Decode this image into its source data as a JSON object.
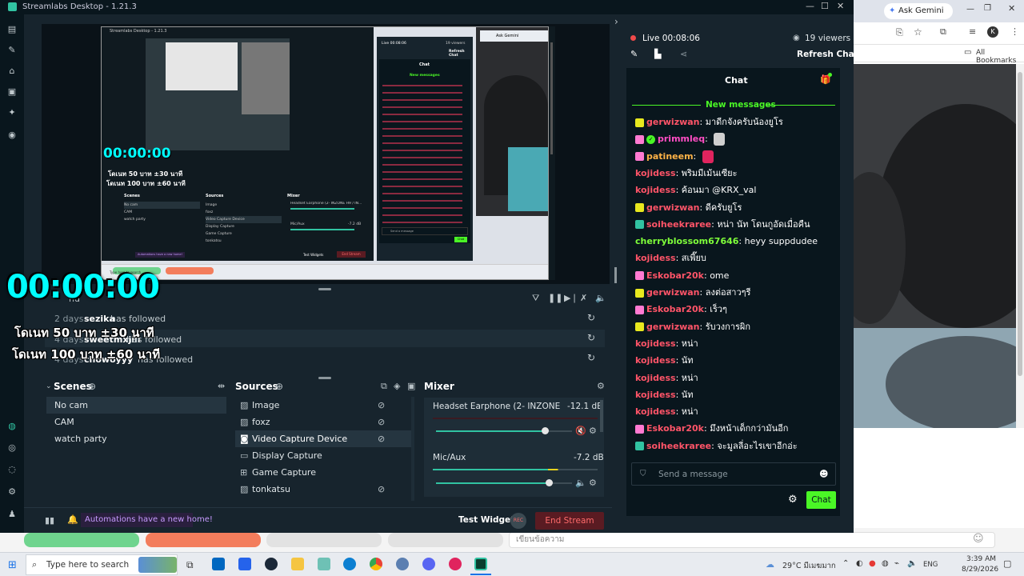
{
  "app": {
    "title": "Streamlabs Desktop - 1.21.3"
  },
  "preview": {
    "timer": "00:00:00",
    "promo_line_1": "โดเนท 50 บาท ±30 นาที",
    "promo_line_2": "โดเนท 100 บาท ±60 นาที",
    "mini_live_label": "Live 00:08:06",
    "mini_viewers": "19 viewers",
    "mini_chat_title": "Chat",
    "mini_refresh": "Refresh Chat",
    "mini_new_messages": "New messages",
    "mini_send_placeholder": "Send a message",
    "mini_chat_button": "Chat",
    "mini_scenes": "Scenes",
    "mini_sources": "Sources",
    "mini_mixer": "Mixer",
    "mini_timer_small": "00:00:00",
    "mini_promo_small_1": "โดเนท 50 บาท ±30 นาที",
    "mini_promo_small_2": "โดเนท 100 บาท ±60 นาที",
    "mini_title": "Streamlabs Desktop - 1.21.3",
    "mini_scene_items": [
      "No cam",
      "CAM",
      "watch party"
    ],
    "mini_source_items": [
      "Image",
      "foxz",
      "Video Capture Device",
      "Display Capture",
      "Game Capture",
      "tonkatsu"
    ],
    "mini_mixer_channel": "Headset Earphone (2- INZONE H9 / IN...",
    "mini_mixer_db": "-12.1 dB",
    "mini_mic_label": "Mic/Aux",
    "mini_mic_db": "-7.2 dB",
    "mini_automations": "Automations have a new home!",
    "mini_test_widgets": "Test Widgets",
    "mini_end_stream": "End Stream",
    "mini_search_placeholder": "Type here to search",
    "mini_tab_label": "Ask Gemini"
  },
  "activity": {
    "title_partial": "nd",
    "rows": [
      {
        "days": "2 days",
        "user": "sezika",
        "action": "has followed"
      },
      {
        "days": "4 days",
        "user": "sweetmxjiii",
        "action": "has followed"
      },
      {
        "days": "4 days",
        "user": "chowoyyy",
        "action": "has followed"
      }
    ]
  },
  "scenes": {
    "title": "Scenes",
    "items": [
      "No cam",
      "CAM",
      "watch party"
    ],
    "selected": "No cam"
  },
  "sources": {
    "title": "Sources",
    "items": [
      {
        "label": "Image",
        "icon": "image-icon"
      },
      {
        "label": "foxz",
        "icon": "image-icon"
      },
      {
        "label": "Video Capture Device",
        "icon": "camera-icon"
      },
      {
        "label": "Display Capture",
        "icon": "monitor-icon"
      },
      {
        "label": "Game Capture",
        "icon": "gamepad-icon"
      },
      {
        "label": "tonkatsu",
        "icon": "image-icon"
      }
    ],
    "selected": "Video Capture Device"
  },
  "mixer": {
    "title": "Mixer",
    "channels": [
      {
        "name": "Headset Earphone (2- INZONE H9 / IN...",
        "db": "-12.1 dB",
        "level": 0.8
      },
      {
        "name": "Mic/Aux",
        "db": "-7.2 dB",
        "level": 0.83
      }
    ]
  },
  "footer": {
    "automations": "Automations have a new home!",
    "test_widgets": "Test Widgets",
    "end_stream": "End Stream"
  },
  "chat": {
    "live_label": "Live 00:08:06",
    "viewers": "19 viewers",
    "refresh": "Refresh Chat",
    "title": "Chat",
    "new_messages": "New messages",
    "send_placeholder": "Send a message",
    "chat_button": "Chat",
    "messages": [
      {
        "user": "gerwizwan",
        "text": "มาดีกจังครับน้องยูโร",
        "color": "#ff5468",
        "badge": "#e8e81e"
      },
      {
        "user": "primmleq",
        "text": "",
        "color": "#ff4dc4",
        "badge": "#ff7ad1",
        "verified": true
      },
      {
        "user": "patineem",
        "text": "",
        "color": "#ffb347",
        "badge": "#ff7ad1"
      },
      {
        "user": "kojidess",
        "text": "พริมมีเม้นเซียะ",
        "color": "#ff5468",
        "badge": ""
      },
      {
        "user": "kojidess",
        "text": "ค้อนมา @KRX_val",
        "color": "#ff5468",
        "badge": ""
      },
      {
        "user": "gerwizwan",
        "text": "ดีครับยูโร",
        "color": "#ff5468",
        "badge": "#e8e81e"
      },
      {
        "user": "soiheekraree",
        "text": "หน่า นัท โดนกูอัดเมื่อคืน",
        "color": "#ff5468",
        "badge": "#31c3a2"
      },
      {
        "user": "cherryblossom67646",
        "text": "heyy suppdudee",
        "color": "#7fff3a",
        "badge": ""
      },
      {
        "user": "kojidess",
        "text": "สเพี๊ยบ",
        "color": "#ff5468",
        "badge": ""
      },
      {
        "user": "Eskobar20k",
        "text": "ome",
        "color": "#ff5468",
        "badge": "#ff7ad1"
      },
      {
        "user": "gerwizwan",
        "text": "ลงต่อสาวๆรี",
        "color": "#ff5468",
        "badge": "#e8e81e"
      },
      {
        "user": "Eskobar20k",
        "text": "เร็วๆ",
        "color": "#ff5468",
        "badge": "#ff7ad1"
      },
      {
        "user": "gerwizwan",
        "text": "รับวงการผิก",
        "color": "#ff5468",
        "badge": "#e8e81e"
      },
      {
        "user": "kojidess",
        "text": "หน่า",
        "color": "#ff5468",
        "badge": ""
      },
      {
        "user": "kojidess",
        "text": "นัท",
        "color": "#ff5468",
        "badge": ""
      },
      {
        "user": "kojidess",
        "text": "หน่า",
        "color": "#ff5468",
        "badge": ""
      },
      {
        "user": "kojidess",
        "text": "นัท",
        "color": "#ff5468",
        "badge": ""
      },
      {
        "user": "kojidess",
        "text": "หน่า",
        "color": "#ff5468",
        "badge": ""
      },
      {
        "user": "Eskobar20k",
        "text": "มึงหน้าเด็กกว่ามันอีก",
        "color": "#ff5468",
        "badge": "#ff7ad1"
      },
      {
        "user": "soiheekraree",
        "text": "จะมูลลี่อะไรเขาอีกอ่ะ",
        "color": "#ff5468",
        "badge": "#31c3a2"
      }
    ]
  },
  "browser": {
    "ask_gemini": "Ask Gemini",
    "all_bookmarks": "All Bookmarks",
    "profile_initial": "K",
    "reply_placeholder": "เขียนข้อความ"
  },
  "taskbar": {
    "search_placeholder": "Type here to search",
    "weather": "29°C มีเมฆมาก",
    "lang": "ENG",
    "time": "3:39 AM",
    "date": "8/29/2026"
  },
  "colors": {
    "accent": "#31c3a2",
    "live_red": "#f04a4a",
    "chat_green": "#4af626",
    "end_stream": "#5a1b22"
  }
}
